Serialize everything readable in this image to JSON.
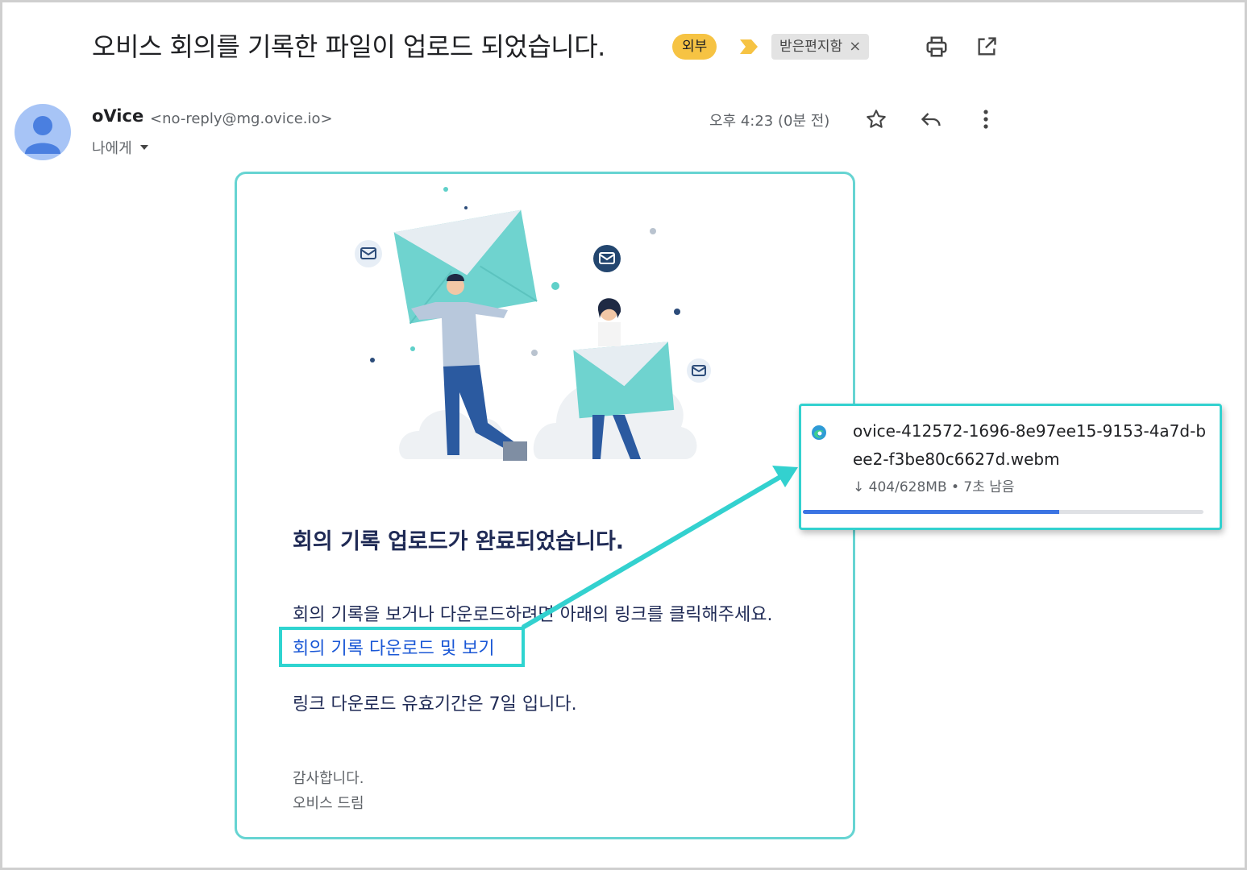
{
  "email": {
    "subject": "오비스 회의를 기록한 파일이 업로드 되었습니다.",
    "labels": {
      "external": "외부",
      "inbox": "받은편지함",
      "remove": "×"
    },
    "sender": {
      "name": "oVice",
      "address": "<no-reply@mg.ovice.io>"
    },
    "recipient": "나에게",
    "time": "오후 4:23 (0분 전)",
    "icons": [
      "print-icon",
      "open-new-window-icon",
      "star-icon",
      "reply-icon",
      "more-vert-icon"
    ]
  },
  "body": {
    "heading": "회의 기록 업로드가 완료되었습니다.",
    "instruction": "회의 기록을 보거나 다운로드하려면 아래의 링크를 클릭해주세요.",
    "link_text": "회의 기록 다운로드 및 보기",
    "validity": "링크 다운로드 유효기간은 7일 입니다.",
    "thanks": "감사합니다.",
    "signature": "오비스 드림"
  },
  "download": {
    "filename": "ovice-412572-1696-8e97ee15-9153-4a7d-bee2-f3be80c6627d.webm",
    "status": "↓ 404/628MB • 7초 남음",
    "progress_fraction": 0.64
  },
  "colors": {
    "accent_teal": "#2fd4d0",
    "link_blue": "#1a57d6",
    "external_chip": "#f6c343",
    "progress_blue": "#3b74e3"
  }
}
